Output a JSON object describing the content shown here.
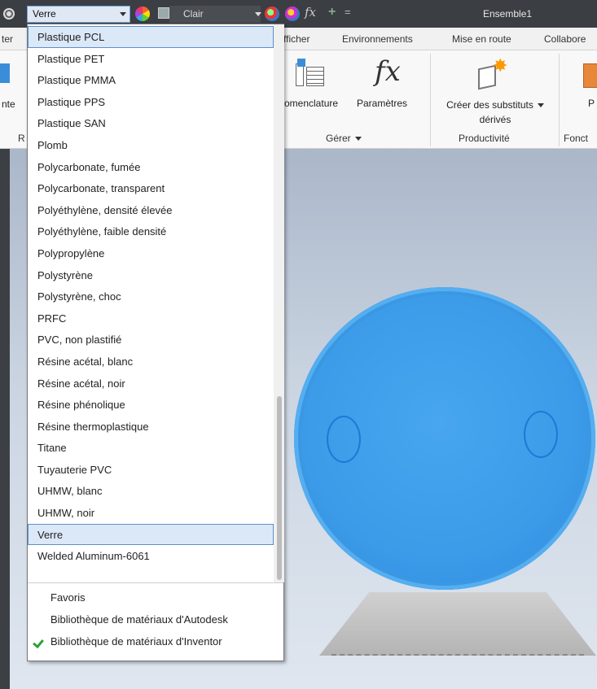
{
  "app": {
    "window_title": "Ensemble1"
  },
  "quick_access": {
    "material_value": "Verre",
    "style_value": "Clair",
    "fx_symbol": "fx",
    "plus_symbol": "+",
    "more_symbol": "=",
    "icons": [
      "material-browser-icon",
      "color-wheel-icon",
      "appearance-swatch-icon",
      "adjust-appearance-icon",
      "clear-appearance-icon",
      "fx-icon",
      "add-icon",
      "customize-icon"
    ]
  },
  "ribbon_tabs": [
    "ter",
    "fficher",
    "Environnements",
    "Mise en route",
    "Collabore"
  ],
  "ribbon": {
    "left_button_label": "nte",
    "left_group_letter": "R",
    "bom_label": "omenclature",
    "params_label": "Paramètres",
    "fx_symbol": "fx",
    "derived_label_line1": "Créer des substituts",
    "derived_label_line2": "dérivés",
    "right_label": "P",
    "group_gerer": "Gérer",
    "group_productivite": "Productivité",
    "group_fonct": "Fonct"
  },
  "materials_dropdown": {
    "items": [
      "Plastique PCL",
      "Plastique PET",
      "Plastique PMMA",
      "Plastique PPS",
      "Plastique SAN",
      "Plomb",
      "Polycarbonate, fumée",
      "Polycarbonate, transparent",
      "Polyéthylène, densité élevée",
      "Polyéthylène, faible densité",
      "Polypropylène",
      "Polystyrène",
      "Polystyrène, choc",
      "PRFC",
      "PVC, non plastifié",
      "Résine acétal, blanc",
      "Résine acétal, noir",
      "Résine phénolique",
      "Résine thermoplastique",
      "Titane",
      "Tuyauterie PVC",
      "UHMW, blanc",
      "UHMW, noir",
      "Verre",
      "Welded Aluminum-6061"
    ],
    "highlighted_items": [
      "Plastique PCL",
      "Verre"
    ],
    "libraries": [
      {
        "label": "Favoris",
        "checked": false
      },
      {
        "label": "Bibliothèque de matériaux d'Autodesk",
        "checked": false
      },
      {
        "label": "Bibliothèque de matériaux d'Inventor",
        "checked": true
      }
    ]
  },
  "colors": {
    "selection_fill": "#dbe8f7",
    "selection_border": "#5d8fcb",
    "model_blue": "#3c9be8",
    "check_green": "#2ba23a"
  }
}
